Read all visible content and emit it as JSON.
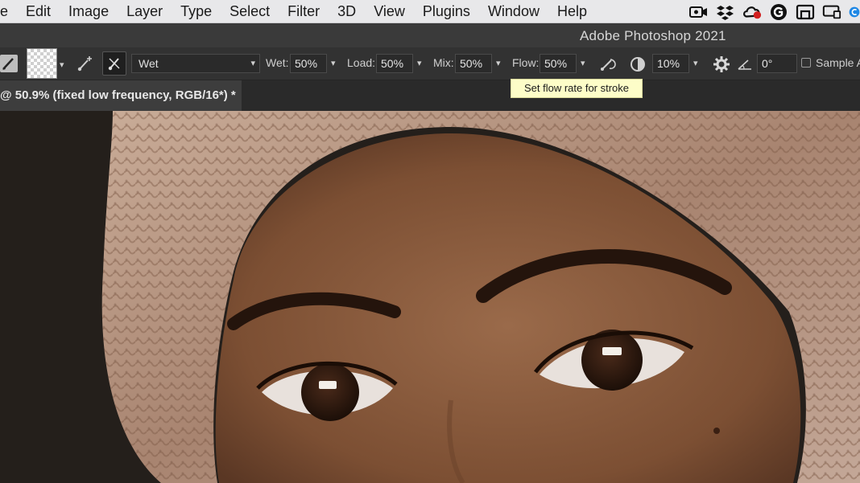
{
  "menubar": {
    "items": [
      "e",
      "Edit",
      "Image",
      "Layer",
      "Type",
      "Select",
      "Filter",
      "3D",
      "View",
      "Plugins",
      "Window",
      "Help"
    ],
    "status_icons": [
      "screen-record-icon",
      "dropbox-icon",
      "creative-cloud-icon",
      "grammarly-icon",
      "display-icon",
      "screen-mirror-icon",
      "app-icon"
    ]
  },
  "app": {
    "title": "Adobe Photoshop 2021"
  },
  "options_bar": {
    "preset": "Wet",
    "wet_label": "Wet:",
    "wet_value": "50%",
    "load_label": "Load:",
    "load_value": "50%",
    "mix_label": "Mix:",
    "mix_value": "50%",
    "flow_label": "Flow:",
    "flow_value": "50%",
    "smoothing_value": "10%",
    "angle_value": "0°",
    "sample_label": "Sample A"
  },
  "tooltip": {
    "text": "Set flow rate for stroke"
  },
  "document": {
    "tab_title": "@ 50.9% (fixed low frequency, RGB/16*) *"
  },
  "colors": {
    "menubar_bg": "#e8e8ea",
    "panel_bg": "#323232",
    "tooltip_bg": "#fdfdc8",
    "skin": "#8a5a3c",
    "scarf": "#b99a86"
  }
}
